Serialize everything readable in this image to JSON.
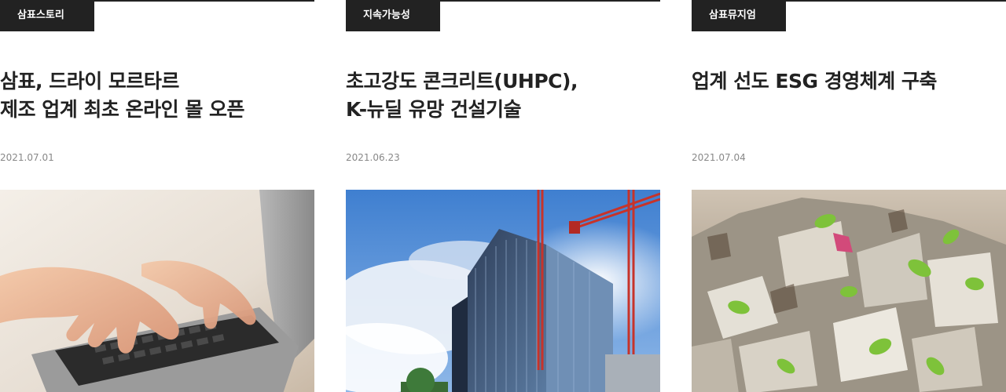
{
  "cards": [
    {
      "category": "삼표스토리",
      "title": "삼표, 드라이 모르타르\n제조 업계 최초 온라인 몰 오픈",
      "date": "2021.07.01"
    },
    {
      "category": "지속가능성",
      "title": "초고강도 콘크리트(UHPC),\nK-뉴딜 유망 건설기술",
      "date": "2021.06.23"
    },
    {
      "category": "삼표뮤지엄",
      "title": "업계 선도 ESG 경영체계 구축",
      "date": "2021.07.04"
    }
  ]
}
